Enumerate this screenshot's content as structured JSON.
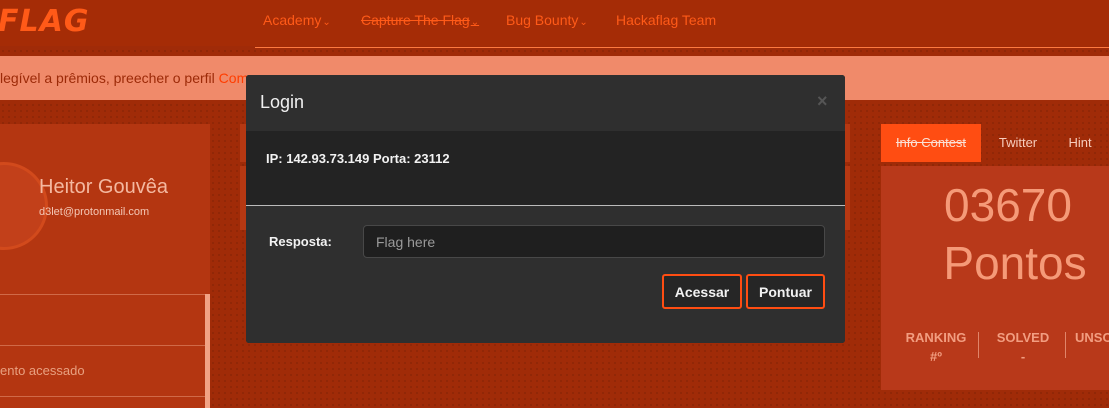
{
  "nav": {
    "logo": "FLAG",
    "items": [
      {
        "label": "Academy",
        "has_caret": true
      },
      {
        "label": "Capture The Flag",
        "has_caret": true
      },
      {
        "label": "Bug Bounty",
        "has_caret": true
      },
      {
        "label": "Hackaflag Team",
        "has_caret": false
      }
    ],
    "caret": "⌄"
  },
  "notice": {
    "text": "legível a prêmios, preecher o perfil ",
    "link": "Com"
  },
  "profile": {
    "name": "Heitor Gouvêa",
    "email": "d3let@protonmail.com",
    "item": "ento acessado"
  },
  "widget": {
    "tabs": [
      "Info Contest",
      "Twitter",
      "Hint"
    ],
    "score": "03670",
    "score_label": "Pontos",
    "stats": [
      {
        "label": "RANKING",
        "value": "#º"
      },
      {
        "label": "SOLVED",
        "value": "-"
      },
      {
        "label": "UNSO",
        "value": ""
      }
    ]
  },
  "modal": {
    "title": "Login",
    "close": "×",
    "info": "IP: 142.93.73.149 Porta: 23112",
    "answer_label": "Resposta:",
    "answer_placeholder": "Flag here",
    "answer_value": "",
    "buttons": {
      "access": "Acessar",
      "score": "Pontuar"
    }
  },
  "colors": {
    "accent": "#ff4d12",
    "background": "#a02b08",
    "modal": "#2f2f2f"
  }
}
